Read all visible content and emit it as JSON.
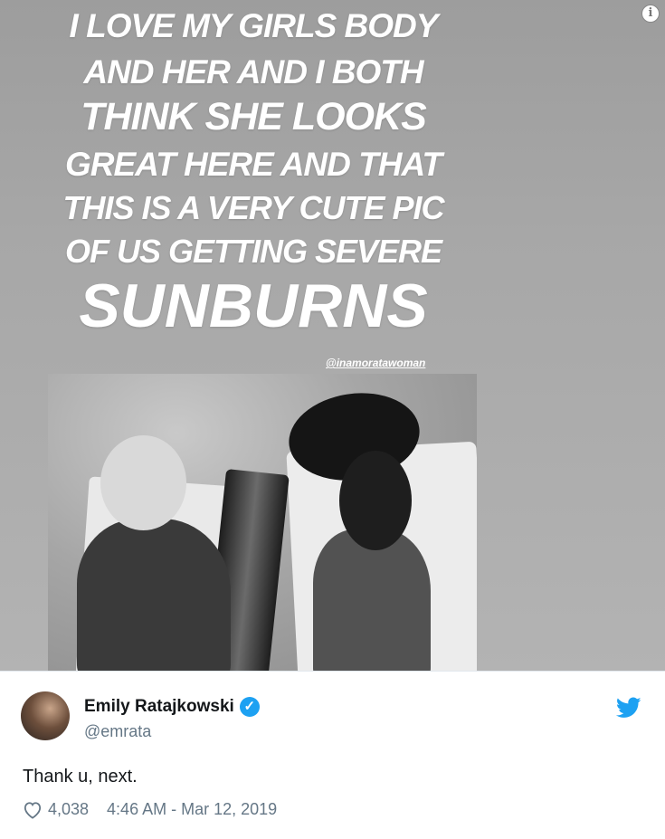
{
  "story": {
    "caption_lines": [
      "I LOVE MY GIRLS BODY",
      "AND HER AND I BOTH",
      "THINK SHE LOOKS",
      "GREAT HERE AND THAT",
      "THIS IS A VERY CUTE PIC",
      "OF US GETTING SEVERE",
      "SUNBURNS"
    ],
    "tag": "@inamoratawoman",
    "info_icon": "info-icon"
  },
  "tweet": {
    "display_name": "Emily Ratajkowski",
    "username": "@emrata",
    "text": "Thank u, next.",
    "likes": "4,038",
    "timestamp": "4:46 AM - Mar 12, 2019",
    "verified_icon": "verified-badge-icon",
    "brand_icon": "twitter-bird-icon",
    "like_icon": "heart-icon",
    "colors": {
      "verified": "#1da1f2",
      "brand": "#1da1f2",
      "secondary_text": "#657786",
      "primary_text": "#14171a"
    }
  }
}
